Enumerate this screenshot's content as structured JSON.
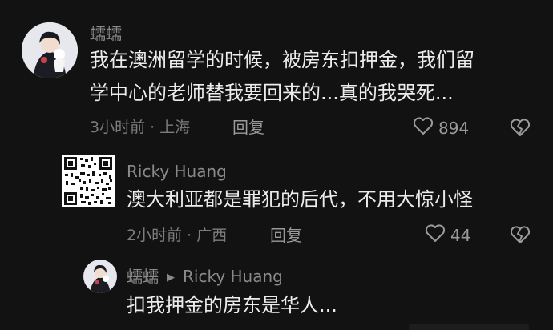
{
  "comments": [
    {
      "username": "蠕蠕",
      "text_lines": [
        "我在澳洲留学的时候，被房东扣押金，我们留",
        "学中心的老师替我要回来的...真的我哭死..."
      ],
      "time_location": "3小时前 · 上海",
      "reply_label": "回复",
      "likes": "894"
    },
    {
      "username": "Ricky Huang",
      "text": "澳大利亚都是罪犯的后代，不用大惊小怪",
      "time_location": "2小时前 · 广西",
      "reply_label": "回复",
      "likes": "44"
    },
    {
      "username": "蠕蠕",
      "reply_to": "Ricky Huang",
      "text": "扣我押金的房东是华人..."
    }
  ],
  "icons": {
    "like": "heart-outline-icon",
    "dislike": "broken-heart-icon",
    "reply_arrow": "triangle-right-icon"
  }
}
